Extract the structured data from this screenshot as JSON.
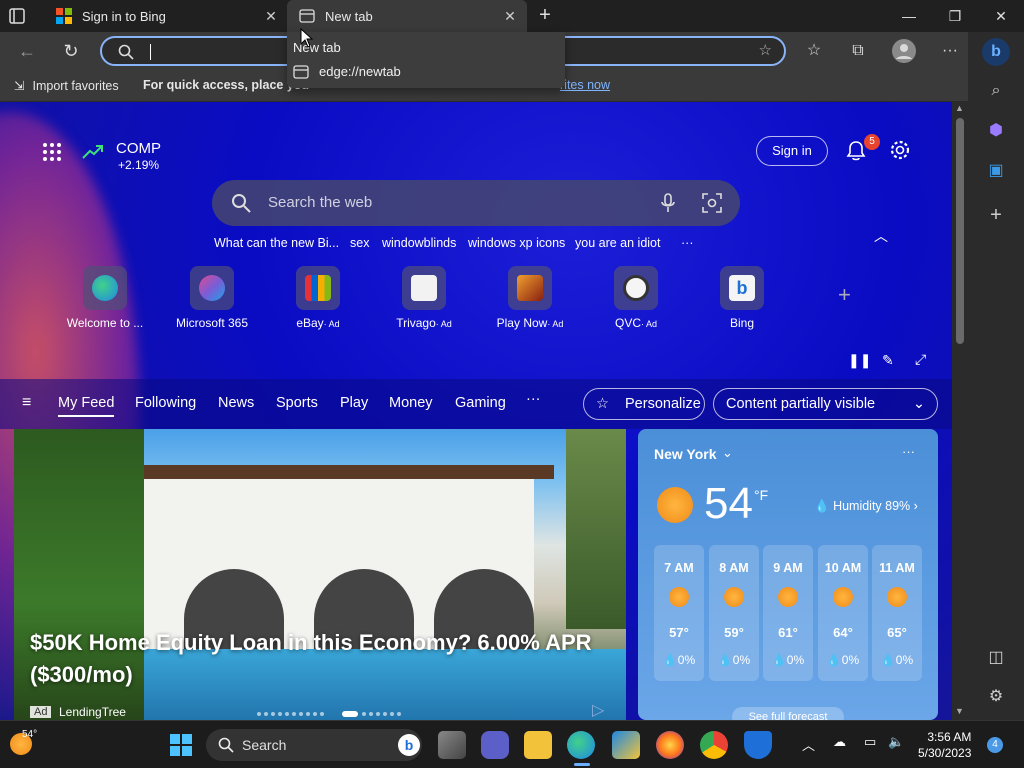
{
  "tabs": [
    {
      "title": "Sign in to Bing",
      "close": "✕"
    },
    {
      "title": "New tab",
      "close": "✕"
    }
  ],
  "window": {
    "new_tab_symbol": "+",
    "minimize": "—",
    "restore": "❐",
    "close": "✕"
  },
  "address": {
    "value": ""
  },
  "dropdown": {
    "header": "New tab",
    "suggestion": "edge://newtab"
  },
  "favorites_bar": {
    "import_label": "Import favorites",
    "message": "For quick access, place you",
    "link": "rites now"
  },
  "stock": {
    "symbol": "COMP",
    "change": "+2.19%"
  },
  "header": {
    "signin": "Sign in",
    "notifications": "5"
  },
  "search": {
    "placeholder": "Search the web"
  },
  "trending": [
    "What can the new Bi...",
    "sex",
    "windowblinds",
    "windows xp icons",
    "you are an idiot",
    "···"
  ],
  "tiles": [
    {
      "label": "Welcome to ...",
      "ad": "",
      "color": "#1e88e5"
    },
    {
      "label": "Microsoft 365",
      "ad": "",
      "color": "#7b5cd6"
    },
    {
      "label": "eBay",
      "ad": "· Ad",
      "color": "#e53238"
    },
    {
      "label": "Trivago",
      "ad": "· Ad",
      "color": "#f2f2f2"
    },
    {
      "label": "Play Now",
      "ad": "· Ad",
      "color": "#b8431e"
    },
    {
      "label": "QVC",
      "ad": "· Ad",
      "color": "#f5f5f5"
    },
    {
      "label": "Bing",
      "ad": "",
      "color": "#f5f5f5"
    }
  ],
  "feed_nav": {
    "items": [
      "My Feed",
      "Following",
      "News",
      "Sports",
      "Play",
      "Money",
      "Gaming"
    ],
    "more": "···",
    "personalize": "Personalize",
    "visibility": "Content partially visible"
  },
  "hero": {
    "title": "$50K Home Equity Loan in this Economy? 6.00% APR ($300/mo)",
    "ad_tag": "Ad",
    "source": "LendingTree"
  },
  "weather": {
    "city": "New York",
    "temp": "54",
    "unit": "°F",
    "humidity": "Humidity 89%",
    "forecast_link": "See full forecast",
    "hours": [
      {
        "time": "7 AM",
        "temp": "57°",
        "precip": "💧0%"
      },
      {
        "time": "8 AM",
        "temp": "59°",
        "precip": "💧0%"
      },
      {
        "time": "9 AM",
        "temp": "61°",
        "precip": "💧0%"
      },
      {
        "time": "10 AM",
        "temp": "64°",
        "precip": "💧0%"
      },
      {
        "time": "11 AM",
        "temp": "65°",
        "precip": "💧0%"
      }
    ]
  },
  "taskbar": {
    "weather_temp": "54°",
    "search_label": "Search",
    "time": "3:56 AM",
    "date": "5/30/2023",
    "notification_count": "4"
  }
}
